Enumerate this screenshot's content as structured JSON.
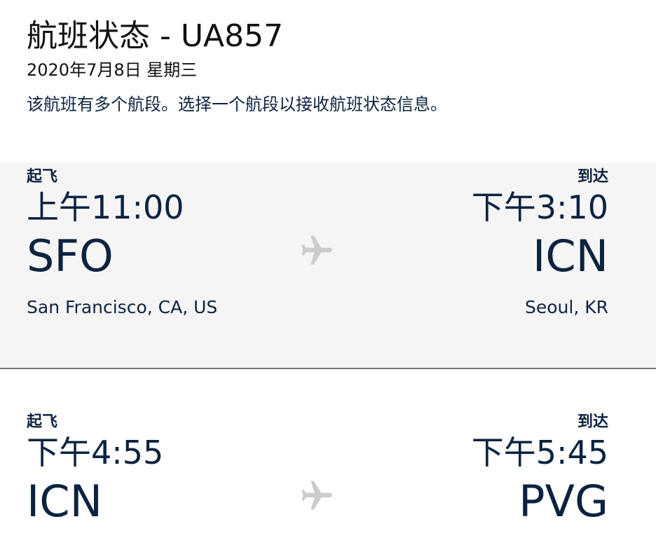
{
  "header": {
    "title": "航班状态 - UA857",
    "date": "2020年7月8日 星期三",
    "info": "该航班有多个航段。选择一个航段以接收航班状态信息。"
  },
  "segments": [
    {
      "depart_label": "起飞",
      "depart_time": "上午11:00",
      "depart_code": "SFO",
      "depart_city": "San Francisco, CA, US",
      "arrive_label": "到达",
      "arrive_time": "下午3:10",
      "arrive_code": "ICN",
      "arrive_city": "Seoul, KR",
      "icon": "airplane-icon",
      "selected": true
    },
    {
      "depart_label": "起飞",
      "depart_time": "下午4:55",
      "depart_code": "ICN",
      "arrive_label": "到达",
      "arrive_time": "下午5:45",
      "arrive_code": "PVG",
      "icon": "airplane-icon",
      "selected": false
    }
  ],
  "colors": {
    "text_primary": "#0c2340",
    "selected_bg": "#f5f5f5",
    "divider": "#777777",
    "icon": "#cccccc"
  }
}
